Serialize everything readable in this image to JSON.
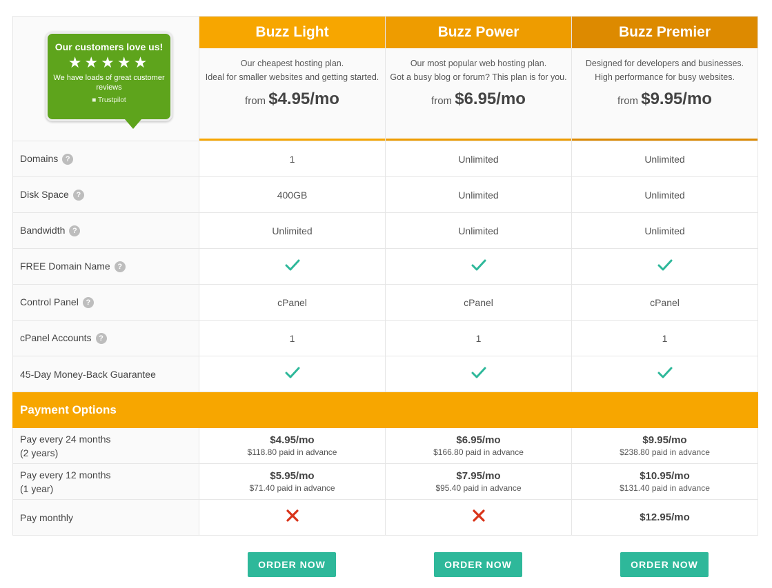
{
  "badge": {
    "title": "Our customers love us!",
    "stars": "★★★★★",
    "subtitle": "We have loads of great customer reviews",
    "brand": "Trustpilot",
    "color": "#5ea41c"
  },
  "plans": [
    {
      "name": "Buzz Light",
      "color": "#f7a600",
      "desc1": "Our cheapest hosting plan.",
      "desc2": "Ideal for smaller websites and getting started.",
      "price_prefix": "from",
      "price": "$4.95/mo"
    },
    {
      "name": "Buzz Power",
      "color": "#ee9c00",
      "desc1": "Our most popular web hosting plan.",
      "desc2": "Got a busy blog or forum? This plan is for you.",
      "price_prefix": "from",
      "price": "$6.95/mo"
    },
    {
      "name": "Buzz Premier",
      "color": "#dd8a00",
      "desc1": "Designed for developers and businesses.",
      "desc2": "High performance for busy websites.",
      "price_prefix": "from",
      "price": "$9.95/mo"
    }
  ],
  "features": [
    {
      "label": "Domains",
      "help": "?",
      "values": [
        "1",
        "Unlimited",
        "Unlimited"
      ]
    },
    {
      "label": "Disk Space",
      "help": "?",
      "values": [
        "400GB",
        "Unlimited",
        "Unlimited"
      ]
    },
    {
      "label": "Bandwidth",
      "help": "?",
      "values": [
        "Unlimited",
        "Unlimited",
        "Unlimited"
      ]
    },
    {
      "label": "FREE Domain Name",
      "help": "?",
      "values": [
        "check",
        "check",
        "check"
      ]
    },
    {
      "label": "Control Panel",
      "help": "?",
      "values": [
        "cPanel",
        "cPanel",
        "cPanel"
      ]
    },
    {
      "label": "cPanel Accounts",
      "help": "?",
      "values": [
        "1",
        "1",
        "1"
      ]
    },
    {
      "label": "45-Day Money-Back Guarantee",
      "help": "",
      "values": [
        "check",
        "check",
        "check"
      ]
    }
  ],
  "payment": {
    "header": "Payment Options",
    "rows": [
      {
        "label1": "Pay every 24 months",
        "label2": "(2 years)",
        "cells": [
          {
            "main": "$4.95/mo",
            "sub": "$118.80 paid in advance"
          },
          {
            "main": "$6.95/mo",
            "sub": "$166.80 paid in advance"
          },
          {
            "main": "$9.95/mo",
            "sub": "$238.80 paid in advance"
          }
        ]
      },
      {
        "label1": "Pay every 12 months",
        "label2": "(1 year)",
        "cells": [
          {
            "main": "$5.95/mo",
            "sub": "$71.40 paid in advance"
          },
          {
            "main": "$7.95/mo",
            "sub": "$95.40 paid in advance"
          },
          {
            "main": "$10.95/mo",
            "sub": "$131.40 paid in advance"
          }
        ]
      },
      {
        "label1": "Pay monthly",
        "label2": "",
        "cells": [
          {
            "main": "cross",
            "sub": ""
          },
          {
            "main": "cross",
            "sub": ""
          },
          {
            "main": "$12.95/mo",
            "sub": ""
          }
        ]
      }
    ]
  },
  "order_label": "ORDER NOW",
  "colors": {
    "check": "#2eb89a",
    "cross": "#d9341a",
    "button": "#2eb89a",
    "payment_header": "#f7a600"
  }
}
